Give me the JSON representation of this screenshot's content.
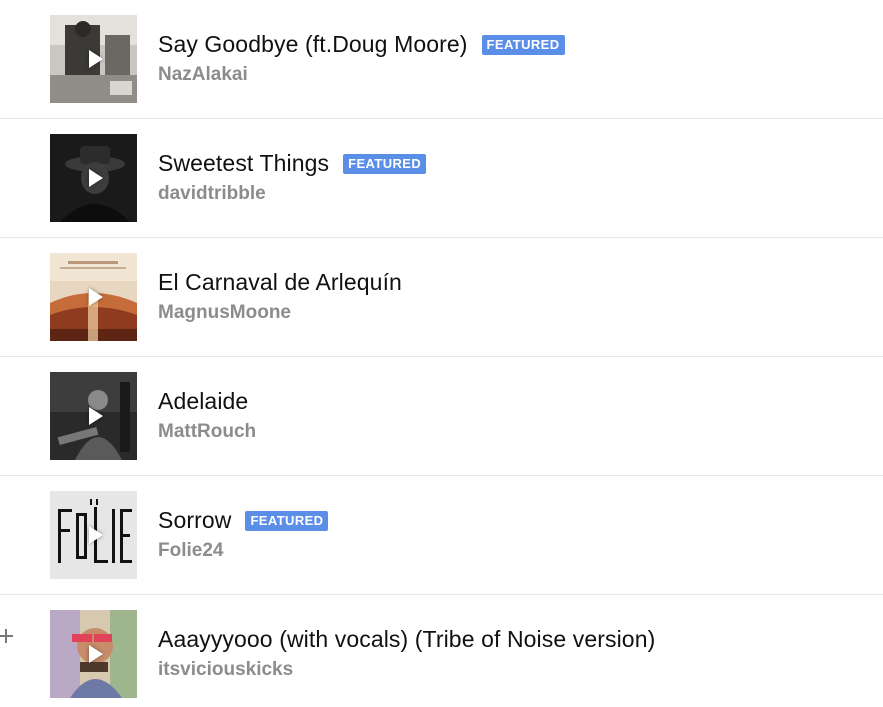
{
  "tracks": [
    {
      "title": "Say Goodbye (ft.Doug Moore)",
      "artist": "NazAlakai",
      "badge": "FEATURED",
      "cover_icon": "play-icon"
    },
    {
      "title": "Sweetest Things",
      "artist": "davidtribble",
      "badge": "FEATURED",
      "cover_icon": "play-icon"
    },
    {
      "title": "El Carnaval de Arlequín",
      "artist": "MagnusMoone",
      "badge": "",
      "cover_icon": "play-icon"
    },
    {
      "title": "Adelaide",
      "artist": "MattRouch",
      "badge": "",
      "cover_icon": "play-icon"
    },
    {
      "title": "Sorrow",
      "artist": "Folie24",
      "badge": "FEATURED",
      "cover_icon": "play-icon"
    },
    {
      "title": "Aaayyyooo (with vocals) (Tribe of Noise version)",
      "artist": "itsviciouskicks",
      "badge": "",
      "cover_icon": "play-icon",
      "side_icon": "add-icon"
    }
  ],
  "colors": {
    "badge_bg": "#5b8ee6",
    "artist_text": "#8c8c8c",
    "divider": "#e9e9e9"
  }
}
